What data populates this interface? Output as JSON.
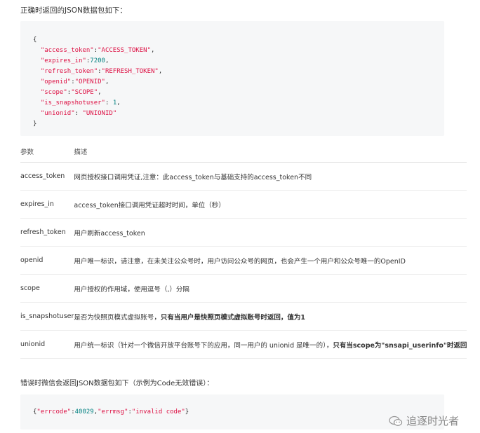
{
  "intro": "正确时返回的JSON数据包如下：",
  "code_success": [
    "{",
    "  \"access_token\":\"ACCESS_TOKEN\",",
    "  \"expires_in\":7200,",
    "  \"refresh_token\":\"REFRESH_TOKEN\",",
    "  \"openid\":\"OPENID\",",
    "  \"scope\":\"SCOPE\",",
    "  \"is_snapshotuser\": 1,",
    "  \"unionid\": \"UNIONID\"",
    "}"
  ],
  "table": {
    "headers": [
      "参数",
      "描述"
    ],
    "rows": [
      {
        "param": "access_token",
        "desc": "网页授权接口调用凭证,注意：此access_token与基础支持的access_token不同",
        "bold": ""
      },
      {
        "param": "expires_in",
        "desc": "access_token接口调用凭证超时时间，单位（秒）",
        "bold": ""
      },
      {
        "param": "refresh_token",
        "desc": "用户刷新access_token",
        "bold": ""
      },
      {
        "param": "openid",
        "desc": "用户唯一标识，请注意，在未关注公众号时，用户访问公众号的网页，也会产生一个用户和公众号唯一的OpenID",
        "bold": ""
      },
      {
        "param": "scope",
        "desc": "用户授权的作用域，使用逗号（,）分隔",
        "bold": ""
      },
      {
        "param": "is_snapshotuser",
        "desc": "是否为快照页模式虚拟账号，",
        "bold": "只有当用户是快照页模式虚拟账号时返回，值为1"
      },
      {
        "param": "unionid",
        "desc": "用户统一标识（针对一个微信开放平台账号下的应用，同一用户的 unionid 是唯一的），",
        "bold": "只有当scope为\"snsapi_userinfo\"时返回"
      }
    ]
  },
  "error_title": "错误时微信会返回JSON数据包如下（示例为Code无效错误）：",
  "code_error": "{\"errcode\":40029,\"errmsg\":\"invalid code\"}",
  "watermark": "追逐时光者",
  "colors": {
    "code_bg": "#f6f7f8",
    "string": "#dd1144",
    "number": "#008080"
  }
}
